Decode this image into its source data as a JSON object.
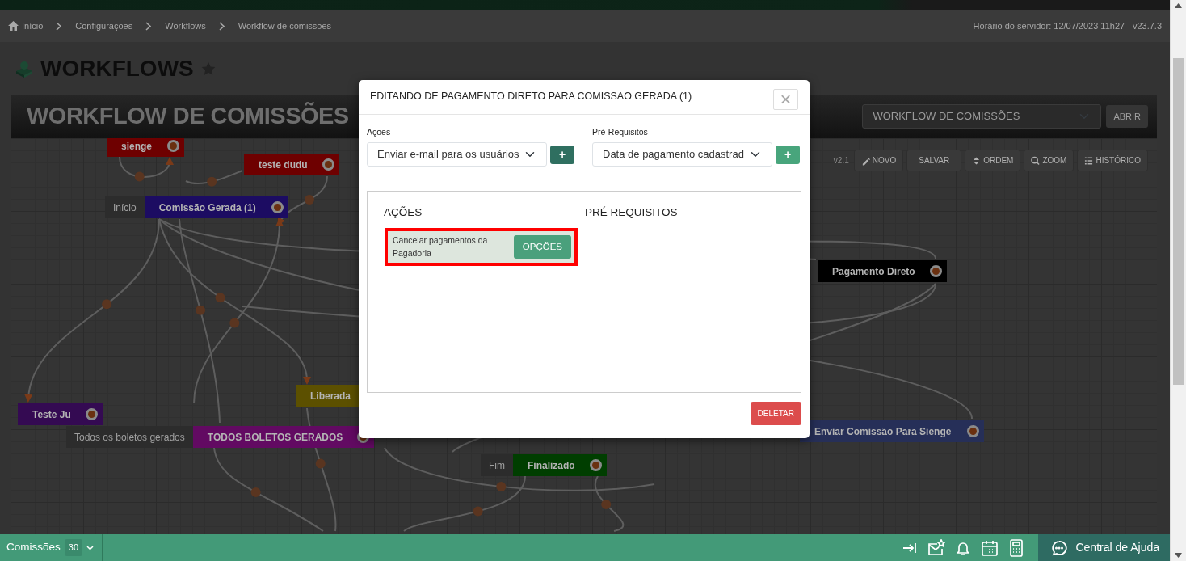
{
  "breadcrumb": [
    {
      "label": "Início"
    },
    {
      "label": "Configurações"
    },
    {
      "label": "Workflows"
    },
    {
      "label": "Workflow de comissões"
    }
  ],
  "server_info": "Horário do servidor: 12/07/2023 11h27 - v23.7.3",
  "page_title": "WORKFLOWS",
  "workflow": {
    "title": "WORKFLOW DE COMISSÕES",
    "selector": "WORKFLOW DE COMISSÕES",
    "open_button": "ABRIR",
    "version": "v2.1",
    "toolbar": [
      {
        "label": "NOVO"
      },
      {
        "label": "SALVAR"
      },
      {
        "label": "ORDEM"
      },
      {
        "label": "ZOOM"
      },
      {
        "label": "HISTÓRICO"
      }
    ],
    "nodes": [
      {
        "label": "sienge",
        "color": "#6e0000"
      },
      {
        "label": "teste dudu",
        "color": "#6e0000"
      },
      {
        "label": "Comissão Gerada (1)",
        "color": "#1c0c62",
        "tag": "Início"
      },
      {
        "label": "Pagamento Direto",
        "color": "#000000"
      },
      {
        "label": "Liberada",
        "color": "#5c5000"
      },
      {
        "label": "Teste Ju",
        "color": "#340a52"
      },
      {
        "label": "TODOS BOLETOS GERADOS",
        "color": "#620a62",
        "tag": "Todos os boletos gerados"
      },
      {
        "label": "Enviar Comissão Para Sienge",
        "color": "#262f58"
      },
      {
        "label": "Finalizado",
        "color": "#003e00",
        "tag": "Fim"
      }
    ]
  },
  "modal": {
    "title": "EDITANDO DE PAGAMENTO DIRETO PARA COMISSÃO GERADA (1)",
    "close": "×",
    "actions_label": "Ações",
    "actions_select": "Enviar e-mail para os usuários",
    "add_action": "+",
    "prereq_label": "Pré-Requisitos",
    "prereq_select": "Data de pagamento cadastrad",
    "add_prereq": "+",
    "actions_heading": "AÇÕES",
    "prereq_heading": "PRÉ REQUISITOS",
    "actions": [
      {
        "text": "Cancelar pagamentos da Pagadoria",
        "button": "OPÇÕES",
        "highlighted": true
      }
    ],
    "delete_button": "DELETAR"
  },
  "footer": {
    "module": "Comissões",
    "count": "30",
    "help": "Central de Ajuda"
  }
}
